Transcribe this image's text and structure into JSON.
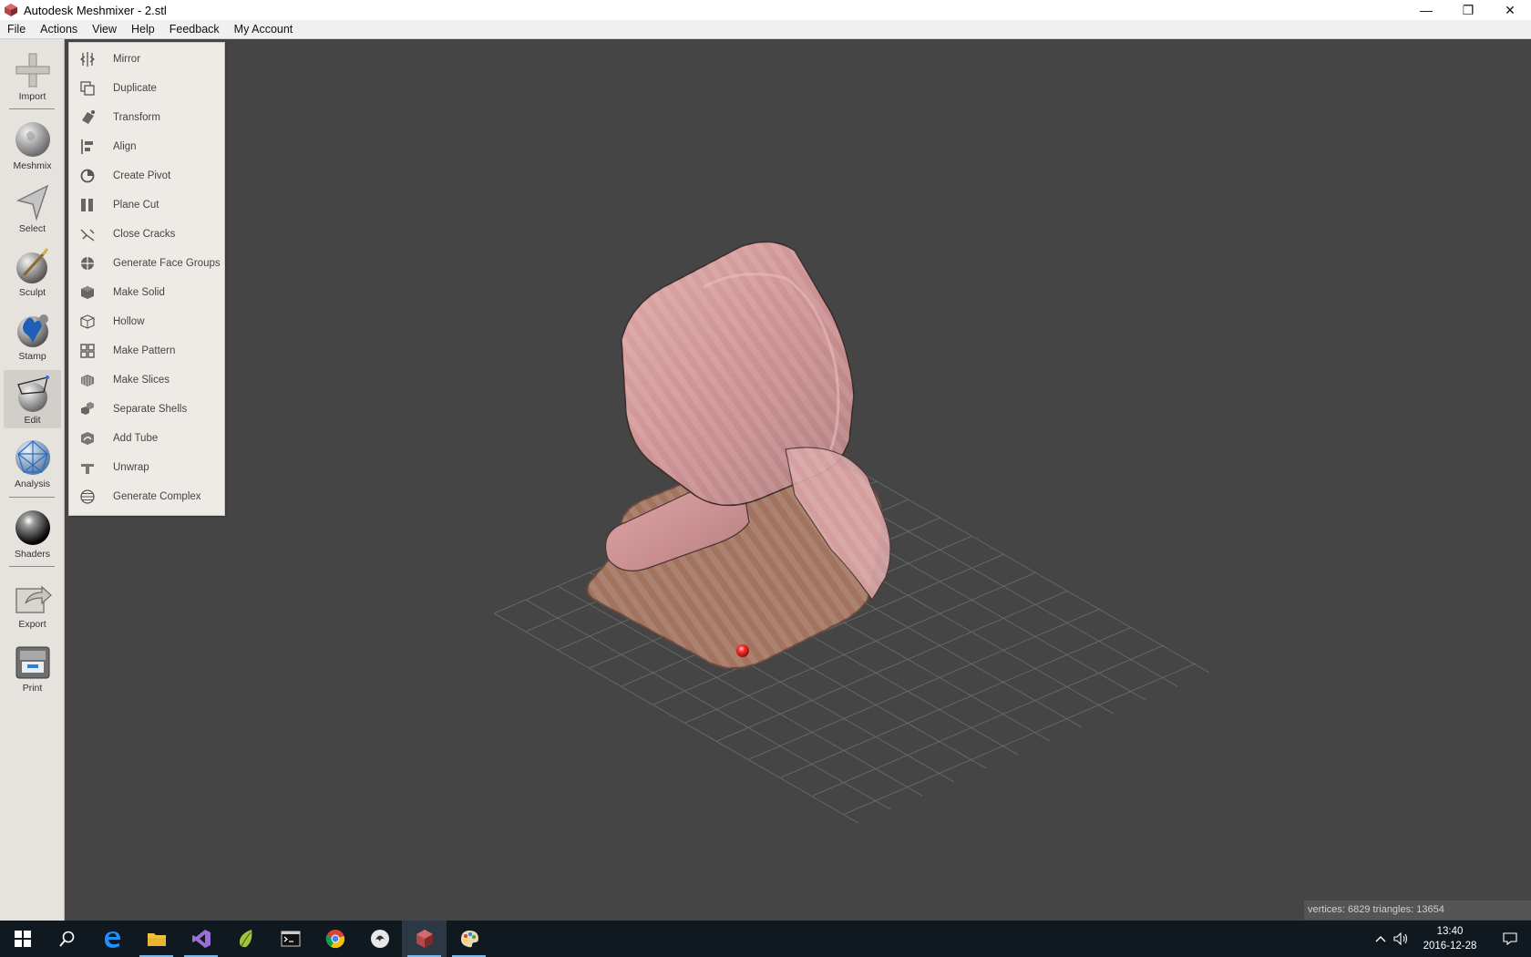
{
  "window": {
    "title": "Autodesk Meshmixer - 2.stl",
    "minimize": "—",
    "maximize": "❐",
    "close": "✕"
  },
  "menubar": [
    "File",
    "Actions",
    "View",
    "Help",
    "Feedback",
    "My Account"
  ],
  "toolbar": {
    "import": "Import",
    "meshmix": "Meshmix",
    "select": "Select",
    "sculpt": "Sculpt",
    "stamp": "Stamp",
    "edit": "Edit",
    "analysis": "Analysis",
    "shaders": "Shaders",
    "export": "Export",
    "print": "Print"
  },
  "edit_menu": [
    {
      "label": "Mirror",
      "icon": "mirror-icon"
    },
    {
      "label": "Duplicate",
      "icon": "duplicate-icon"
    },
    {
      "label": "Transform",
      "icon": "transform-icon"
    },
    {
      "label": "Align",
      "icon": "align-icon"
    },
    {
      "label": "Create Pivot",
      "icon": "pivot-icon"
    },
    {
      "label": "Plane Cut",
      "icon": "plane-cut-icon"
    },
    {
      "label": "Close Cracks",
      "icon": "close-cracks-icon"
    },
    {
      "label": "Generate Face Groups",
      "icon": "face-groups-icon"
    },
    {
      "label": "Make Solid",
      "icon": "make-solid-icon"
    },
    {
      "label": "Hollow",
      "icon": "hollow-icon"
    },
    {
      "label": "Make Pattern",
      "icon": "make-pattern-icon"
    },
    {
      "label": "Make Slices",
      "icon": "make-slices-icon"
    },
    {
      "label": "Separate Shells",
      "icon": "separate-shells-icon"
    },
    {
      "label": "Add Tube",
      "icon": "add-tube-icon"
    },
    {
      "label": "Unwrap",
      "icon": "unwrap-icon"
    },
    {
      "label": "Generate Complex",
      "icon": "generate-complex-icon"
    }
  ],
  "status": {
    "mesh_stats": "vertices: 6829 triangles: 13654"
  },
  "taskbar": {
    "apps": [
      "windows-start",
      "search",
      "edge",
      "file-explorer",
      "visual-studio",
      "sublime",
      "terminal",
      "chrome",
      "inkscape",
      "meshmixer",
      "paint"
    ],
    "time": "13:40",
    "date": "2016-12-28"
  },
  "colors": {
    "viewport_bg": "#454545",
    "mesh": "#d4999a",
    "mesh_base": "#a87565",
    "pivot": "#ff3030",
    "taskbar": "#101820"
  }
}
